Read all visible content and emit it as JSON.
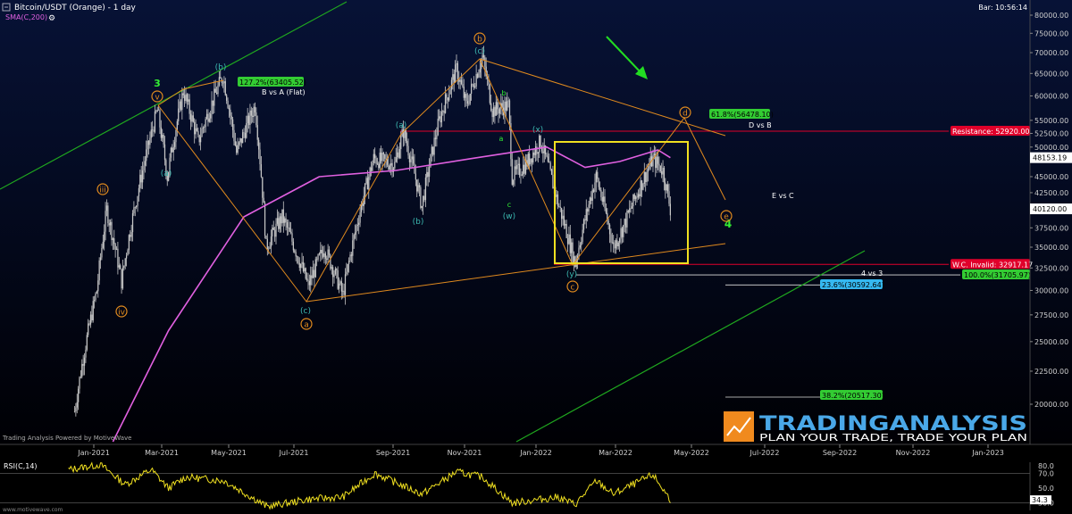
{
  "header": {
    "title": "Bitcoin/USDT (Orange) - 1 day",
    "indicator": "SMA(C,200)",
    "bar_time": "Bar: 10:56:14",
    "footer_left": "Trading Analysis Powered by MotiveWave",
    "footer_url": "www.motivewave.com"
  },
  "logo": {
    "brand": "TRADINGANALYSIS",
    "tagline": "PLAN YOUR TRADE, TRADE YOUR PLAN"
  },
  "colors": {
    "background": "#000000",
    "candles": "#c8c8c8",
    "sma": "#e060e0",
    "wave_lines": "#e08a1e",
    "channel": "#1fa81f",
    "resistance": "#e0002a",
    "box": "#f0e020",
    "rsi": "#f0e020"
  },
  "price_axis": {
    "ticks": [
      "80000.00",
      "75000.00",
      "70000.00",
      "65000.00",
      "60000.00",
      "55000.00",
      "52500.00",
      "50000.00",
      "45000.00",
      "42500.00",
      "40000.00",
      "37500.00",
      "35000.00",
      "32500.00",
      "30000.00",
      "27500.00",
      "25000.00",
      "22500.00",
      "20000.00"
    ],
    "last_price": "48153.19",
    "current_price": "40120.00"
  },
  "time_axis": {
    "labels": [
      "Jan-2021",
      "Mar-2021",
      "May-2021",
      "Jul-2021",
      "Sep-2021",
      "Nov-2021",
      "Jan-2022",
      "Mar-2022",
      "May-2022",
      "Jul-2022",
      "Sep-2022",
      "Nov-2022",
      "Jan-2023"
    ]
  },
  "levels": {
    "resistance": "Resistance: 52920.00",
    "wc_invalid": "W.C. Invalid: 32917.17",
    "fib_100": "100.0%(31705.97)",
    "fib_236": "23.6%(30592.64)",
    "fib_382": "38.2%(20517.30)",
    "fib_1272": "127.2%(63405.52)",
    "fib_618": "61.8%(56478.10)"
  },
  "annotations": {
    "b_vs_a": "B vs A (Flat)",
    "d_vs_b": "D vs B",
    "e_vs_c": "E vs C",
    "four_vs_three": "4 vs 3",
    "wave3": "3",
    "wave4": "4",
    "v": "v",
    "iii": "iii",
    "iv": "iv",
    "a": "a",
    "b": "b",
    "c": "c",
    "d": "d",
    "e": "e",
    "paren_a": "(a)",
    "paren_b": "(b)",
    "paren_c": "(c)",
    "paren_w": "(w)",
    "paren_x": "(x)",
    "paren_y": "(y)",
    "small_a": "a",
    "small_b": "b",
    "small_c": "c"
  },
  "rsi": {
    "label": "RSI(C,14)",
    "ticks": [
      "80.0",
      "70.0",
      "50.0",
      "30.0"
    ],
    "current": "34.3"
  },
  "chart_data": {
    "type": "candlestick",
    "title": "Bitcoin/USDT (Orange) - 1 day",
    "ylabel": "",
    "ylim": [
      17500,
      82000
    ],
    "x_range": [
      "2020-12-01",
      "2023-02-01"
    ],
    "grid": false,
    "price_path": [
      [
        "2020-12-15",
        19500
      ],
      [
        "2021-01-02",
        30000
      ],
      [
        "2021-01-10",
        40000
      ],
      [
        "2021-01-22",
        31000
      ],
      [
        "2021-02-08",
        46000
      ],
      [
        "2021-02-20",
        57000
      ],
      [
        "2021-02-28",
        45000
      ],
      [
        "2021-03-13",
        61000
      ],
      [
        "2021-03-25",
        51000
      ],
      [
        "2021-04-14",
        64500
      ],
      [
        "2021-04-25",
        49000
      ],
      [
        "2021-05-10",
        58000
      ],
      [
        "2021-05-19",
        35000
      ],
      [
        "2021-06-01",
        39000
      ],
      [
        "2021-06-22",
        30500
      ],
      [
        "2021-07-05",
        35000
      ],
      [
        "2021-07-20",
        29500
      ],
      [
        "2021-08-14",
        48000
      ],
      [
        "2021-08-31",
        47000
      ],
      [
        "2021-09-07",
        52900
      ],
      [
        "2021-09-22",
        40500
      ],
      [
        "2021-10-06",
        55000
      ],
      [
        "2021-10-20",
        66000
      ],
      [
        "2021-10-28",
        58000
      ],
      [
        "2021-11-10",
        69000
      ],
      [
        "2021-11-18",
        57000
      ],
      [
        "2021-12-01",
        58000
      ],
      [
        "2021-12-04",
        45000
      ],
      [
        "2021-12-15",
        47000
      ],
      [
        "2021-12-27",
        51000
      ],
      [
        "2022-01-10",
        41000
      ],
      [
        "2022-01-24",
        33000
      ],
      [
        "2022-02-10",
        45000
      ],
      [
        "2022-02-24",
        35000
      ],
      [
        "2022-03-05",
        38000
      ],
      [
        "2022-03-28",
        48000
      ],
      [
        "2022-04-05",
        46000
      ],
      [
        "2022-04-11",
        40120
      ]
    ],
    "sma200_path": [
      [
        "2021-01-15",
        17500
      ],
      [
        "2021-03-01",
        26000
      ],
      [
        "2021-05-01",
        39000
      ],
      [
        "2021-07-01",
        45000
      ],
      [
        "2021-09-01",
        46000
      ],
      [
        "2021-11-01",
        48000
      ],
      [
        "2022-01-01",
        50000
      ],
      [
        "2022-02-01",
        46500
      ],
      [
        "2022-03-01",
        47500
      ],
      [
        "2022-04-01",
        49500
      ],
      [
        "2022-04-11",
        48153.19
      ]
    ],
    "wave_labels": [
      {
        "label": "3",
        "date": "2021-02-21",
        "price": 60500
      },
      {
        "label": "a",
        "date": "2021-06-22",
        "price": 29500
      },
      {
        "label": "b",
        "date": "2021-11-10",
        "price": 69000
      },
      {
        "label": "c",
        "date": "2022-01-24",
        "price": 32917.17
      },
      {
        "label": "d",
        "date": "2022-04-20",
        "price": 56478.1
      },
      {
        "label": "e",
        "date": "2022-05-25",
        "price": 38500
      }
    ],
    "levels": [
      {
        "name": "Resistance",
        "value": 52920.0
      },
      {
        "name": "W.C. Invalid",
        "value": 32917.17
      },
      {
        "name": "100.0%",
        "value": 31705.97
      },
      {
        "name": "23.6%",
        "value": 30592.64
      },
      {
        "name": "38.2%",
        "value": 20517.3
      },
      {
        "name": "127.2%",
        "value": 63405.52
      },
      {
        "name": "61.8%",
        "value": 56478.1
      }
    ],
    "rsi_path": [
      [
        "2020-12-10",
        75
      ],
      [
        "2021-01-05",
        82
      ],
      [
        "2021-01-25",
        55
      ],
      [
        "2021-02-15",
        75
      ],
      [
        "2021-03-01",
        50
      ],
      [
        "2021-03-15",
        65
      ],
      [
        "2021-04-15",
        60
      ],
      [
        "2021-05-20",
        25
      ],
      [
        "2021-06-22",
        35
      ],
      [
        "2021-07-20",
        38
      ],
      [
        "2021-08-15",
        70
      ],
      [
        "2021-09-22",
        42
      ],
      [
        "2021-10-20",
        72
      ],
      [
        "2021-11-10",
        65
      ],
      [
        "2021-12-04",
        30
      ],
      [
        "2022-01-10",
        38
      ],
      [
        "2022-01-24",
        28
      ],
      [
        "2022-02-10",
        60
      ],
      [
        "2022-02-24",
        42
      ],
      [
        "2022-03-28",
        68
      ],
      [
        "2022-04-11",
        34.3
      ]
    ]
  }
}
